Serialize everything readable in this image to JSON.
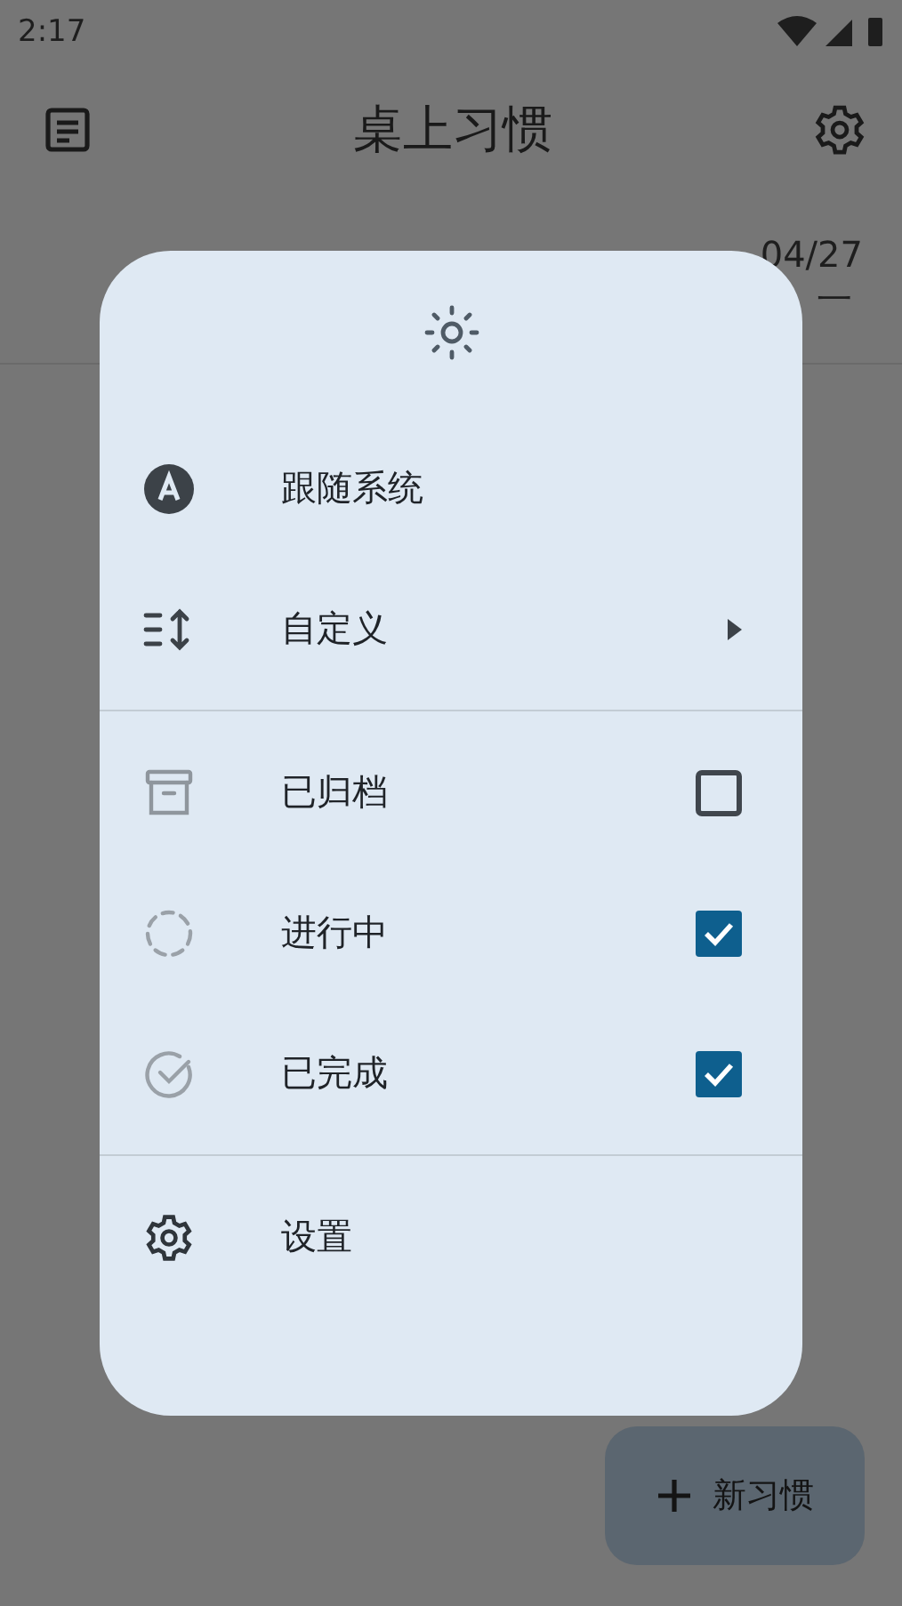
{
  "status_bar": {
    "time": "2:17"
  },
  "app_bar": {
    "title": "桌上习惯"
  },
  "header": {
    "date": "04/27",
    "weekday": "一"
  },
  "dialog": {
    "sections": [
      {
        "items": [
          {
            "kind": "option",
            "label": "跟随系统"
          },
          {
            "kind": "submenu",
            "label": "自定义"
          }
        ]
      },
      {
        "items": [
          {
            "kind": "filter",
            "label": "已归档",
            "checked": false
          },
          {
            "kind": "filter",
            "label": "进行中",
            "checked": true
          },
          {
            "kind": "filter",
            "label": "已完成",
            "checked": true
          }
        ]
      },
      {
        "items": [
          {
            "kind": "action",
            "label": "设置"
          }
        ]
      }
    ]
  },
  "fab": {
    "label": "新习惯"
  }
}
